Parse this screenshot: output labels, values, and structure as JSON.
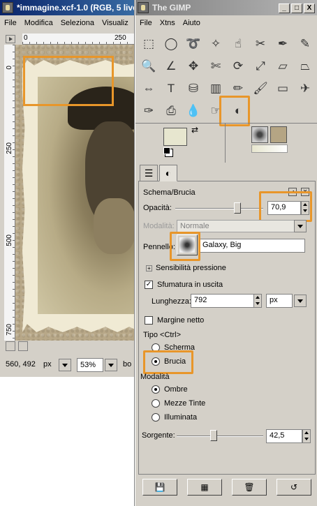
{
  "image_window": {
    "title": "*immagine.xcf-1.0 (RGB, 5 live",
    "menu": [
      "File",
      "Modifica",
      "Seleziona",
      "Visualiz"
    ],
    "ruler_h_labels": [
      "0",
      "250"
    ],
    "ruler_v_labels": [
      "0",
      "250",
      "500",
      "750"
    ],
    "coords": "560, 492",
    "unit": "px",
    "zoom": "53%",
    "status_tail": "bo"
  },
  "toolbox": {
    "title": "The GIMP",
    "menu": [
      "File",
      "Xtns",
      "Aiuto"
    ],
    "win_buttons": [
      "_",
      "□",
      "X"
    ]
  },
  "tools": [
    {
      "name": "rect-select-icon",
      "glyph": "⬚"
    },
    {
      "name": "ellipse-select-icon",
      "glyph": "◯"
    },
    {
      "name": "lasso-icon",
      "glyph": "➰"
    },
    {
      "name": "fuzzy-select-icon",
      "glyph": "✧"
    },
    {
      "name": "color-select-icon",
      "glyph": "☝"
    },
    {
      "name": "scissors-icon",
      "glyph": "✂"
    },
    {
      "name": "paths-icon",
      "glyph": "✒"
    },
    {
      "name": "color-picker-icon",
      "glyph": "✎"
    },
    {
      "name": "zoom-icon",
      "glyph": "🔍"
    },
    {
      "name": "measure-icon",
      "glyph": "∠"
    },
    {
      "name": "move-icon",
      "glyph": "✥"
    },
    {
      "name": "crop-icon",
      "glyph": "✄"
    },
    {
      "name": "rotate-icon",
      "glyph": "⟳"
    },
    {
      "name": "scale-icon",
      "glyph": "⤢"
    },
    {
      "name": "shear-icon",
      "glyph": "▱"
    },
    {
      "name": "perspective-icon",
      "glyph": "⏢"
    },
    {
      "name": "flip-icon",
      "glyph": "⇔"
    },
    {
      "name": "text-icon",
      "glyph": "T"
    },
    {
      "name": "bucket-fill-icon",
      "glyph": "⛁"
    },
    {
      "name": "blend-icon",
      "glyph": "▥"
    },
    {
      "name": "pencil-icon",
      "glyph": "✏"
    },
    {
      "name": "paintbrush-icon",
      "glyph": "🖌"
    },
    {
      "name": "eraser-icon",
      "glyph": "▭"
    },
    {
      "name": "airbrush-icon",
      "glyph": "✈"
    },
    {
      "name": "ink-icon",
      "glyph": "✑"
    },
    {
      "name": "clone-icon",
      "glyph": "⎙"
    },
    {
      "name": "blur-icon",
      "glyph": "💧"
    },
    {
      "name": "smudge-icon",
      "glyph": "☞"
    },
    {
      "name": "dodge-burn-icon",
      "glyph": "◐"
    }
  ],
  "options": {
    "title": "Schema/Brucia",
    "opacity_label": "Opacità:",
    "opacity_value": "70,9",
    "opacity_fraction": 0.709,
    "mode_label": "Modalità:",
    "mode_value": "Normale",
    "brush_label": "Pennello:",
    "brush_name": "Galaxy, Big",
    "pressure_label": "Sensibilità pressione",
    "fade_label": "Sfumatura in uscita",
    "length_label": "Lunghezza:",
    "length_value": "792",
    "length_unit": "px",
    "hard_edge_label": "Margine netto",
    "type_label": "Tipo  <Ctrl>",
    "type_dodge": "Scherma",
    "type_burn": "Brucia",
    "mode_section": "Modalità",
    "range_shadows": "Ombre",
    "range_midtones": "Mezze Tinte",
    "range_highlights": "Illuminata",
    "exposure_label": "Sorgente:",
    "exposure_value": "42,5",
    "exposure_fraction": 0.425
  },
  "accent_color": "#e8962a"
}
